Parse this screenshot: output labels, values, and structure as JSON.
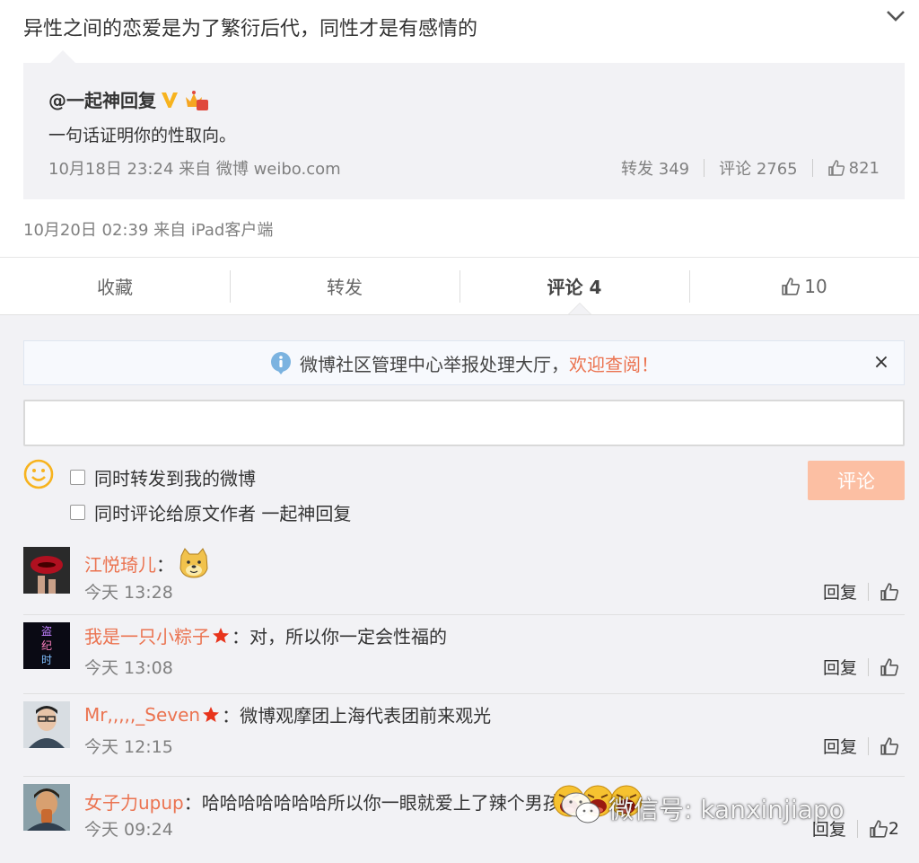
{
  "post": {
    "text": "异性之间的恋爱是为了繁衍后代，同性才是有感情的",
    "meta": "10月20日 02:39 来自 iPad客户端"
  },
  "quote": {
    "user": "@一起神回复",
    "level": "5",
    "text": "一句话证明你的性取向。",
    "meta": "10月18日 23:24 来自 微博 weibo.com",
    "repost": "转发 349",
    "comment": "评论 2765",
    "likes": "821"
  },
  "actions": {
    "favorite": "收藏",
    "repost": "转发",
    "comment": "评论 4",
    "likes": "10"
  },
  "notice": {
    "text": "微博社区管理中心举报处理大厅，",
    "link": "欢迎查阅！",
    "close": "×"
  },
  "composer": {
    "option1": "同时转发到我的微博",
    "option2": "同时评论给原文作者 一起神回复",
    "submit": "评论"
  },
  "comments": [
    {
      "user": "江悦琦儿",
      "sep": "：",
      "text": "",
      "time": "今天 13:28",
      "reply": "回复",
      "likes": ""
    },
    {
      "user": "我是一只小粽子",
      "sep": "：",
      "text": "对，所以你一定会性福的",
      "time": "今天 13:08",
      "reply": "回复",
      "likes": ""
    },
    {
      "user": "Mr,,,,,_Seven",
      "sep": "：",
      "text": "微博观摩团上海代表团前来观光",
      "time": "今天 12:15",
      "reply": "回复",
      "likes": ""
    },
    {
      "user": "女子力upup",
      "sep": "：",
      "text": "哈哈哈哈哈哈哈所以你一眼就爱上了辣个男孩子",
      "time": "今天 09:24",
      "reply": "回复",
      "likes": "2"
    }
  ],
  "avatar2_text": [
    "盗",
    "纪",
    "时"
  ],
  "watermark": "微信号: kanxinjiapo",
  "colors": {
    "accent": "#eb7350",
    "submit_bg": "#fcbfa3",
    "badge_v": "#f7b31e",
    "panel": "#f2f2f5"
  }
}
